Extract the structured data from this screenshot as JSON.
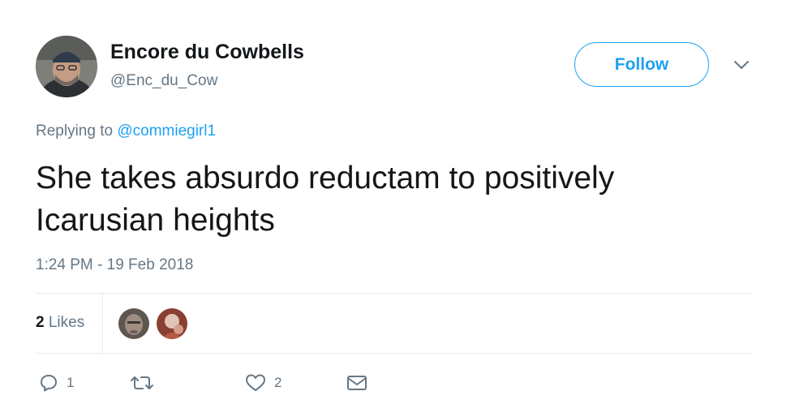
{
  "tweet": {
    "author": {
      "display_name": "Encore du Cowbells",
      "screen_name": "@Enc_du_Cow",
      "avatar_icon": "user-avatar"
    },
    "follow_label": "Follow",
    "menu_icon": "chevron-down-icon",
    "reply_context": {
      "prefix": "Replying to",
      "mention": "@commiegirl1"
    },
    "text": "She takes absurdo reductam to positively Icarusian heights",
    "timestamp": "1:24 PM - 19 Feb 2018",
    "stats": {
      "likes_count": "2",
      "likes_label": "Likes",
      "likers": [
        "liker-avatar-1",
        "liker-avatar-2"
      ]
    },
    "actions": {
      "reply_count": "1",
      "retweet_count": "",
      "like_count": "2"
    }
  },
  "colors": {
    "accent": "#1da1f2",
    "text_primary": "#14171a",
    "text_secondary": "#657786",
    "divider": "#e6ecf0"
  }
}
